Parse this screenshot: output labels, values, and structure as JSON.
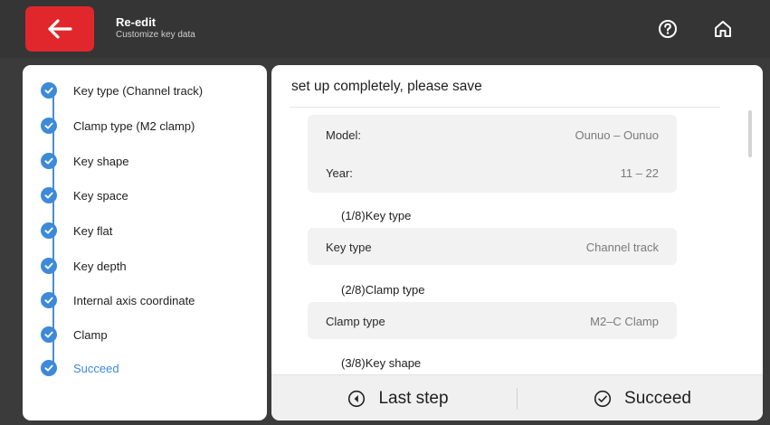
{
  "header": {
    "title": "Re-edit",
    "subtitle": "Customize key data",
    "back_icon": "arrow-left-icon",
    "help_icon": "question-circle-icon",
    "home_icon": "home-icon",
    "accent": "#e2272c"
  },
  "steps": [
    {
      "label": "Key type (Channel track)",
      "done": true
    },
    {
      "label": "Clamp type (M2 clamp)",
      "done": true
    },
    {
      "label": "Key shape",
      "done": true
    },
    {
      "label": "Key space",
      "done": true
    },
    {
      "label": "Key flat",
      "done": true
    },
    {
      "label": "Key depth",
      "done": true
    },
    {
      "label": "Internal axis coordinate",
      "done": true
    },
    {
      "label": "Clamp",
      "done": true
    },
    {
      "label": "Succeed",
      "done": true,
      "active": true
    }
  ],
  "summary": {
    "heading": "set up completely, please save",
    "model_label": "Model:",
    "model_value": "Ounuo – Ounuo",
    "year_label": "Year:",
    "year_value": "11 – 22",
    "section1": "(1/8)Key type",
    "key_type_label": "Key type",
    "key_type_value": "Channel track",
    "section2": "(2/8)Clamp type",
    "clamp_type_label": "Clamp type",
    "clamp_type_value": "M2–C Clamp",
    "section3": "(3/8)Key shape"
  },
  "footer": {
    "last_step": "Last step",
    "succeed": "Succeed"
  },
  "colors": {
    "step_blue": "#3d8ad8",
    "topbar": "#353535"
  }
}
